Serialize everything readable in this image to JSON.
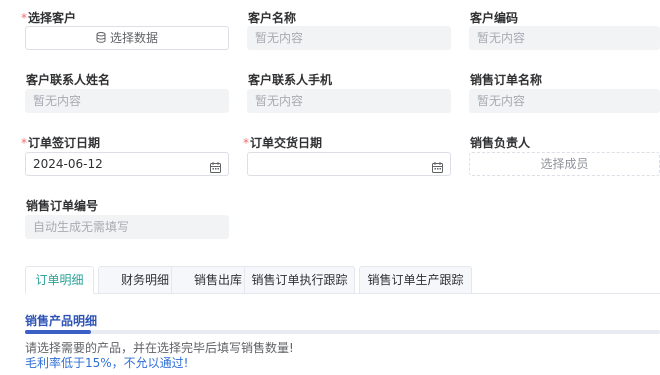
{
  "form": {
    "customer_select": {
      "label": "选择客户",
      "required": true,
      "button_label": "选择数据",
      "icon": "database-icon"
    },
    "customer_name": {
      "label": "客户名称",
      "placeholder": "暂无内容"
    },
    "customer_code": {
      "label": "客户编码",
      "placeholder": "暂无内容"
    },
    "contact_name": {
      "label": "客户联系人姓名",
      "placeholder": "暂无内容"
    },
    "contact_phone": {
      "label": "客户联系人手机",
      "placeholder": "暂无内容"
    },
    "order_name": {
      "label": "销售订单名称",
      "placeholder": "暂无内容"
    },
    "sign_date": {
      "label": "订单签订日期",
      "required": true,
      "value": "2024-06-12",
      "icon": "calendar-icon"
    },
    "delivery_date": {
      "label": "订单交货日期",
      "required": true,
      "value": "",
      "icon": "calendar-icon"
    },
    "sales_owner": {
      "label": "销售负责人",
      "button_label": "选择成员"
    },
    "order_number": {
      "label": "销售订单编号",
      "placeholder": "自动生成无需填写"
    }
  },
  "tabs": [
    {
      "label": "订单明细",
      "active": true
    },
    {
      "label": "财务明细",
      "active": false
    },
    {
      "label": "销售出库",
      "active": false
    },
    {
      "label": "销售订单执行跟踪",
      "active": false
    },
    {
      "label": "销售订单生产跟踪",
      "active": false
    }
  ],
  "section": {
    "title": "销售产品明细",
    "tip_text": "请选择需要的产品，并在选择完毕后填写销售数量!",
    "warning_text": "毛利率低于15%，不允以通过!"
  },
  "colors": {
    "required_mark": "#f56c6c",
    "active_tab": "#2aa198",
    "section_title": "#2f54b7",
    "tip_text": "#606266",
    "warning_text": "#2f6fd8"
  }
}
